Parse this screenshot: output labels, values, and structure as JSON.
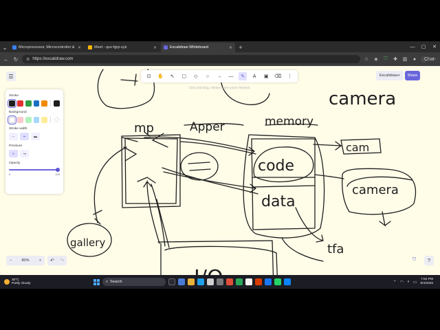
{
  "browser": {
    "tabs": [
      {
        "title": "Microprocessor, Microcontroller &",
        "color": "#3b82f6",
        "active": false
      },
      {
        "title": "Meet - qux-fgrp-syk",
        "color": "#f4b400",
        "active": false
      },
      {
        "title": "Excalidraw Whiteboard",
        "color": "#6965db",
        "active": true
      }
    ],
    "url": "https://excalidraw.com",
    "chat_label": "Chat"
  },
  "app": {
    "toolbar_hint": "Click and drag, release when you're finished",
    "excalidraw_plus": "Excalidraw+",
    "share": "Share",
    "zoom_level": "80%"
  },
  "panel": {
    "stroke_label": "Stroke",
    "stroke_colors": [
      "#1e1e1e",
      "#e03131",
      "#2f9e44",
      "#1971c2",
      "#f08c00"
    ],
    "stroke_current": "#1e1e1e",
    "background_label": "Background",
    "background_colors": [
      "#ffffff",
      "#ffc9c9",
      "#b2f2bb",
      "#a5d8ff",
      "#ffec99"
    ],
    "stroke_width_label": "Stroke width",
    "pressure_label": "Pressure",
    "opacity_label": "Opacity",
    "opacity_min": "0",
    "opacity_max": "100",
    "opacity_value": 1.0
  },
  "canvas_text": {
    "mp": "mp",
    "appear": "Apper",
    "memory": "memory",
    "camera_top": "camera",
    "code": "code",
    "data": "data",
    "cam": "cam",
    "camera_box": "camera",
    "gallery": "gallery",
    "io": "I/O",
    "tfa": "tfa"
  },
  "taskbar": {
    "temp": "30°C",
    "weather": "Partly cloudy",
    "search": "Search",
    "time": "7:54 PM",
    "date": "9/4/2026"
  }
}
